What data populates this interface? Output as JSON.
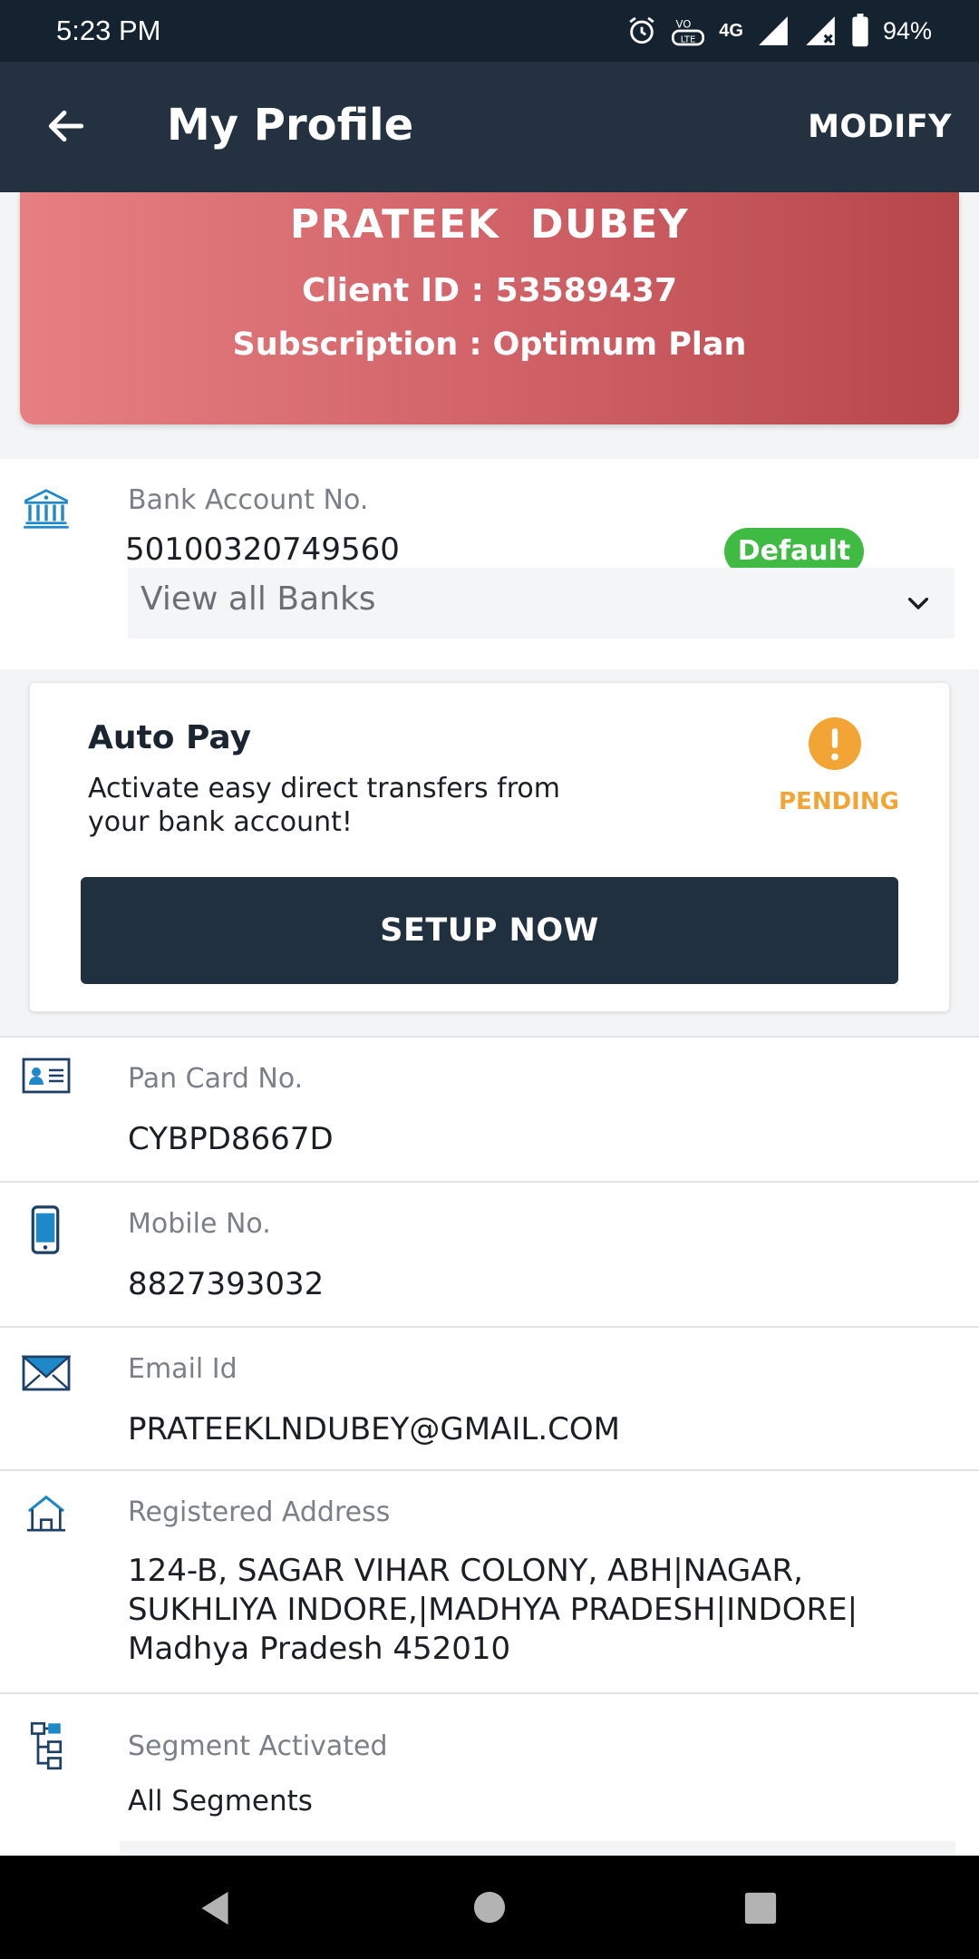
{
  "status_bar": {
    "time": "5:23 PM",
    "network": "4G",
    "battery": "94%"
  },
  "app_bar": {
    "title": "My Profile",
    "action": "MODIFY"
  },
  "profile": {
    "name": "PRATEEK  DUBEY",
    "client_id": "Client ID : 53589437",
    "subscription": "Subscription : Optimum Plan"
  },
  "bank": {
    "label": "Bank Account No.",
    "account_no": "50100320749560",
    "badge": "Default",
    "select_label": "View all Banks"
  },
  "autopay": {
    "title": "Auto Pay",
    "description": "Activate easy direct transfers from your bank account!",
    "status": "PENDING",
    "button": "SETUP NOW"
  },
  "pan": {
    "label": "Pan Card No.",
    "value": "CYBPD8667D"
  },
  "mobile": {
    "label": "Mobile No.",
    "value": "8827393032"
  },
  "email": {
    "label": "Email Id",
    "value": "PRATEEKLNDUBEY@GMAIL.COM"
  },
  "address": {
    "label": "Registered Address",
    "line1": "124-B, SAGAR VIHAR COLONY, ABH|NAGAR,",
    "line2": "SUKHLIYA INDORE,|MADHYA PRADESH|INDORE|",
    "line3": "Madhya Pradesh 452010"
  },
  "segment": {
    "label": "Segment Activated",
    "value": "All Segments"
  },
  "colors": {
    "header": "#233140",
    "card_start": "#e67f82",
    "card_end": "#b64648",
    "badge": "#3fba43",
    "pending": "#f2a535",
    "icon": "#1e88c9"
  }
}
